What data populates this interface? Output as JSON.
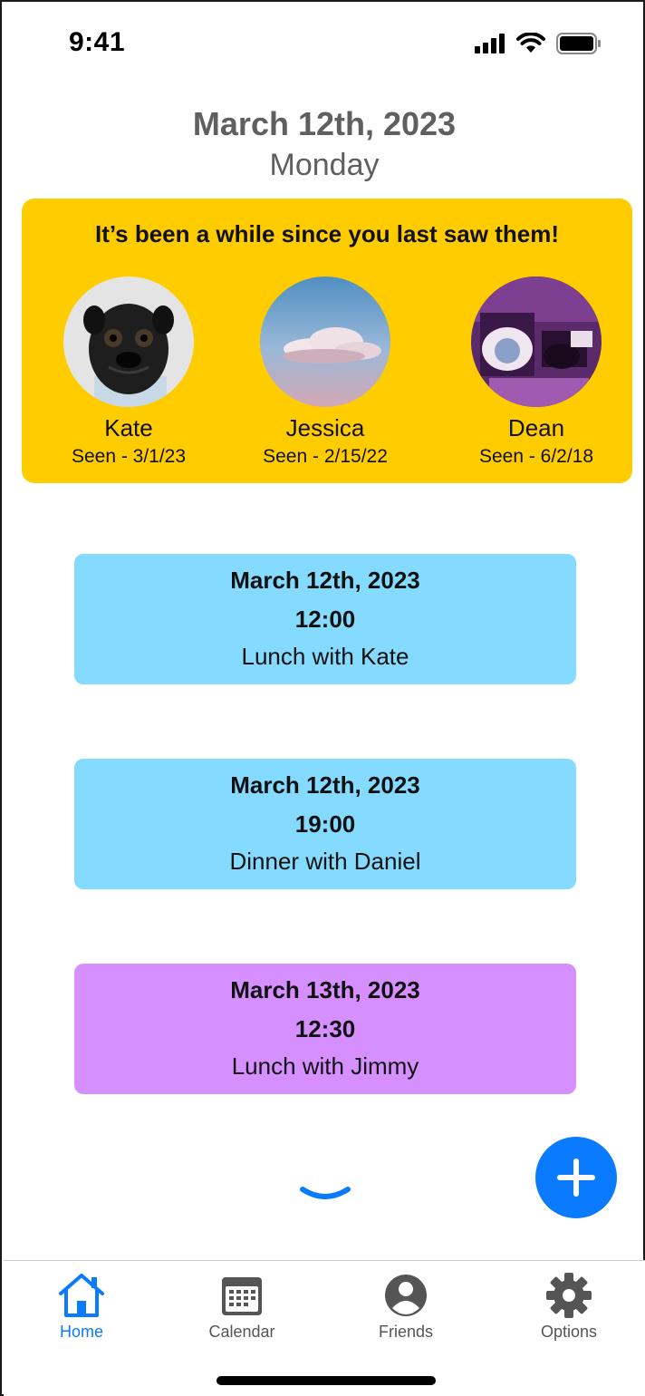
{
  "status_bar": {
    "time": "9:41"
  },
  "header": {
    "date": "March 12th, 2023",
    "day": "Monday"
  },
  "reminder": {
    "title": "It’s been a while since you last saw them!",
    "friends": [
      {
        "name": "Kate",
        "seen": "Seen - 3/1/23"
      },
      {
        "name": "Jessica",
        "seen": "Seen - 2/15/22"
      },
      {
        "name": "Dean",
        "seen": "Seen - 6/2/18"
      }
    ]
  },
  "events": [
    {
      "date": "March 12th, 2023",
      "time": "12:00",
      "title": "Lunch with Kate",
      "color": "#84dbff"
    },
    {
      "date": "March 12th, 2023",
      "time": "19:00",
      "title": "Dinner with Daniel",
      "color": "#84dbff"
    },
    {
      "date": "March 13th, 2023",
      "time": "12:30",
      "title": "Lunch with Jimmy",
      "color": "#d68fff"
    }
  ],
  "tabs": [
    {
      "label": "Home",
      "icon": "home-icon",
      "active": true
    },
    {
      "label": "Calendar",
      "icon": "calendar-icon",
      "active": false
    },
    {
      "label": "Friends",
      "icon": "person-icon",
      "active": false
    },
    {
      "label": "Options",
      "icon": "gear-icon",
      "active": false
    }
  ],
  "colors": {
    "accent": "#0a7aff",
    "reminder_bg": "#ffcc00",
    "header_text": "#5f5f5f"
  }
}
